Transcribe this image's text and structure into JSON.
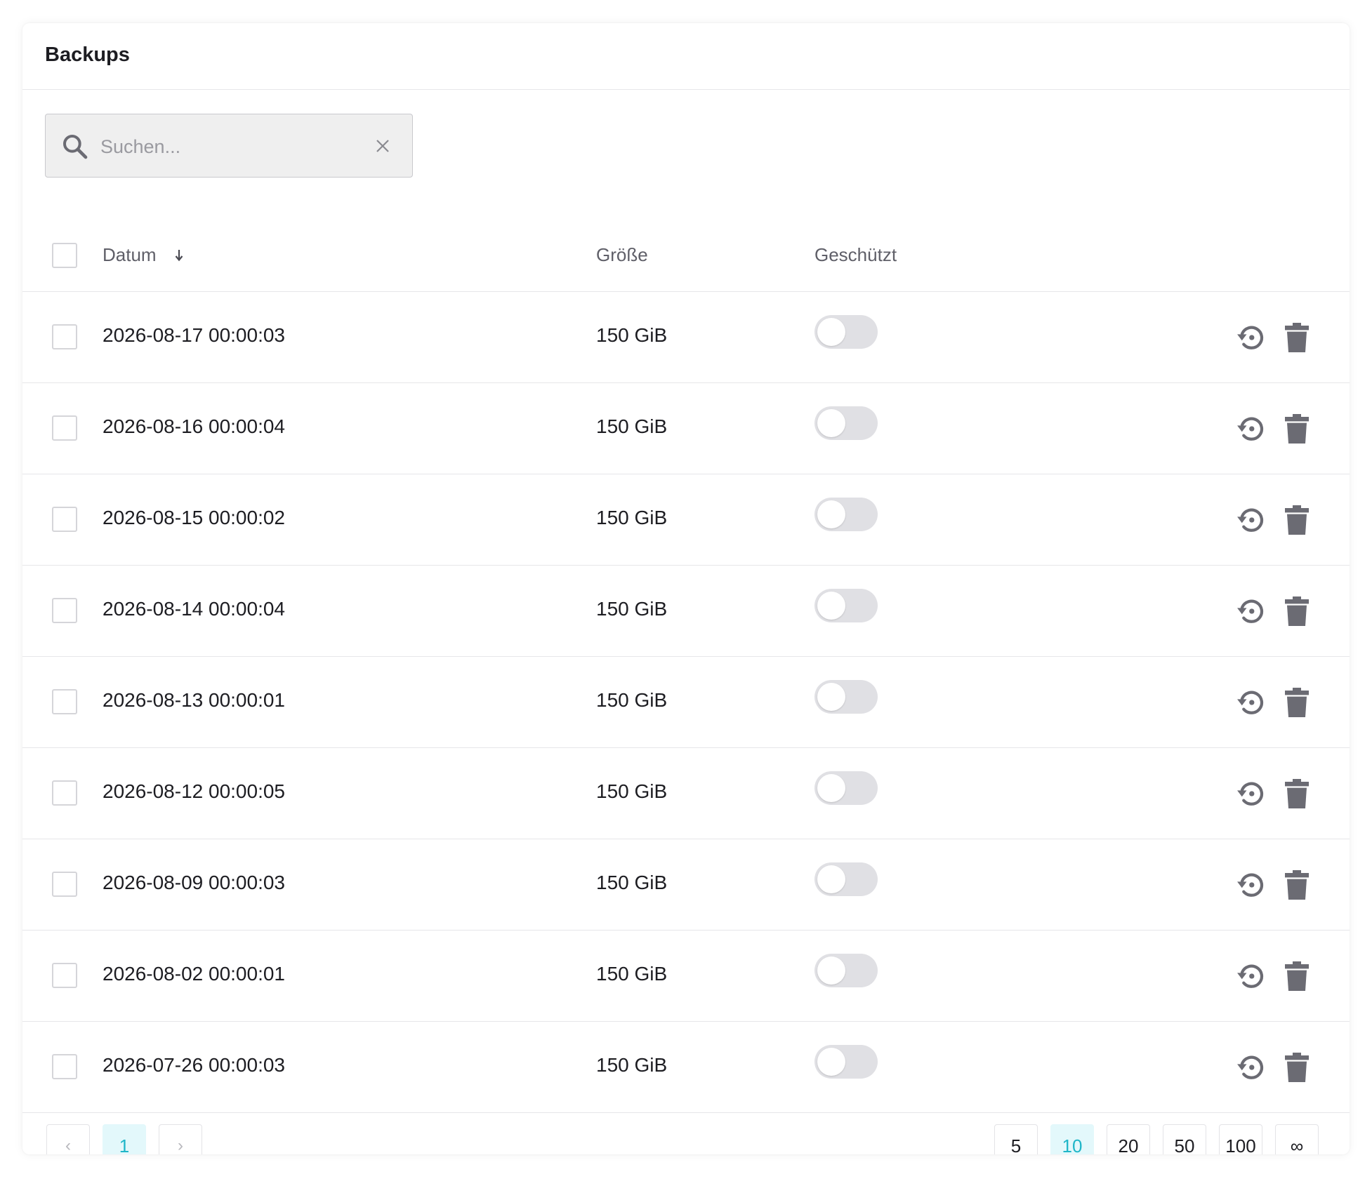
{
  "card": {
    "title": "Backups"
  },
  "search": {
    "placeholder": "Suchen...",
    "value": ""
  },
  "table": {
    "columns": {
      "date": "Datum",
      "size": "Größe",
      "protected": "Geschützt"
    },
    "rows": [
      {
        "date": "2026-08-17 00:00:03",
        "size": "150 GiB",
        "protected": false
      },
      {
        "date": "2026-08-16 00:00:04",
        "size": "150 GiB",
        "protected": false
      },
      {
        "date": "2026-08-15 00:00:02",
        "size": "150 GiB",
        "protected": false
      },
      {
        "date": "2026-08-14 00:00:04",
        "size": "150 GiB",
        "protected": false
      },
      {
        "date": "2026-08-13 00:00:01",
        "size": "150 GiB",
        "protected": false
      },
      {
        "date": "2026-08-12 00:00:05",
        "size": "150 GiB",
        "protected": false
      },
      {
        "date": "2026-08-09 00:00:03",
        "size": "150 GiB",
        "protected": false
      },
      {
        "date": "2026-08-02 00:00:01",
        "size": "150 GiB",
        "protected": false
      },
      {
        "date": "2026-07-26 00:00:03",
        "size": "150 GiB",
        "protected": false
      }
    ],
    "row_icons": {
      "restore": "restore-icon",
      "delete": "trash-icon"
    }
  },
  "pagination": {
    "prev": "‹",
    "next": "›",
    "pages": [
      "1"
    ],
    "current_page": "1",
    "page_sizes": [
      "5",
      "10",
      "20",
      "50",
      "100",
      "∞"
    ],
    "selected_page_size": "10"
  },
  "colors": {
    "accent": "#1fb6c8",
    "accent_bg": "#e3f8fb",
    "icon": "#6b6b73",
    "toggle_off": "#e0e0e4"
  }
}
